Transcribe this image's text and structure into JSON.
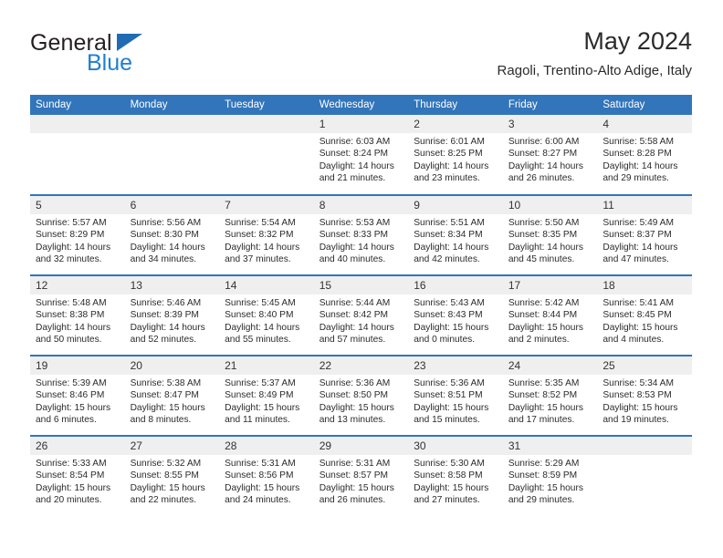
{
  "brand": {
    "name_part1": "General",
    "name_part2": "Blue",
    "triangle_color": "#1f6cb4",
    "blue_color": "#1f7fd0"
  },
  "header": {
    "title": "May 2024",
    "subtitle": "Ragoli, Trentino-Alto Adige, Italy"
  },
  "theme": {
    "header_bg": "#3275ba",
    "daynum_bg": "#efefef",
    "row_divider": "#3275ba",
    "text": "#2b2b2b"
  },
  "calendar": {
    "weekday_headers": [
      "Sunday",
      "Monday",
      "Tuesday",
      "Wednesday",
      "Thursday",
      "Friday",
      "Saturday"
    ],
    "weeks": [
      [
        {
          "day": "",
          "empty": true
        },
        {
          "day": "",
          "empty": true
        },
        {
          "day": "",
          "empty": true
        },
        {
          "day": "1",
          "sunrise": "Sunrise: 6:03 AM",
          "sunset": "Sunset: 8:24 PM",
          "daylight_1": "Daylight: 14 hours",
          "daylight_2": "and 21 minutes."
        },
        {
          "day": "2",
          "sunrise": "Sunrise: 6:01 AM",
          "sunset": "Sunset: 8:25 PM",
          "daylight_1": "Daylight: 14 hours",
          "daylight_2": "and 23 minutes."
        },
        {
          "day": "3",
          "sunrise": "Sunrise: 6:00 AM",
          "sunset": "Sunset: 8:27 PM",
          "daylight_1": "Daylight: 14 hours",
          "daylight_2": "and 26 minutes."
        },
        {
          "day": "4",
          "sunrise": "Sunrise: 5:58 AM",
          "sunset": "Sunset: 8:28 PM",
          "daylight_1": "Daylight: 14 hours",
          "daylight_2": "and 29 minutes."
        }
      ],
      [
        {
          "day": "5",
          "sunrise": "Sunrise: 5:57 AM",
          "sunset": "Sunset: 8:29 PM",
          "daylight_1": "Daylight: 14 hours",
          "daylight_2": "and 32 minutes."
        },
        {
          "day": "6",
          "sunrise": "Sunrise: 5:56 AM",
          "sunset": "Sunset: 8:30 PM",
          "daylight_1": "Daylight: 14 hours",
          "daylight_2": "and 34 minutes."
        },
        {
          "day": "7",
          "sunrise": "Sunrise: 5:54 AM",
          "sunset": "Sunset: 8:32 PM",
          "daylight_1": "Daylight: 14 hours",
          "daylight_2": "and 37 minutes."
        },
        {
          "day": "8",
          "sunrise": "Sunrise: 5:53 AM",
          "sunset": "Sunset: 8:33 PM",
          "daylight_1": "Daylight: 14 hours",
          "daylight_2": "and 40 minutes."
        },
        {
          "day": "9",
          "sunrise": "Sunrise: 5:51 AM",
          "sunset": "Sunset: 8:34 PM",
          "daylight_1": "Daylight: 14 hours",
          "daylight_2": "and 42 minutes."
        },
        {
          "day": "10",
          "sunrise": "Sunrise: 5:50 AM",
          "sunset": "Sunset: 8:35 PM",
          "daylight_1": "Daylight: 14 hours",
          "daylight_2": "and 45 minutes."
        },
        {
          "day": "11",
          "sunrise": "Sunrise: 5:49 AM",
          "sunset": "Sunset: 8:37 PM",
          "daylight_1": "Daylight: 14 hours",
          "daylight_2": "and 47 minutes."
        }
      ],
      [
        {
          "day": "12",
          "sunrise": "Sunrise: 5:48 AM",
          "sunset": "Sunset: 8:38 PM",
          "daylight_1": "Daylight: 14 hours",
          "daylight_2": "and 50 minutes."
        },
        {
          "day": "13",
          "sunrise": "Sunrise: 5:46 AM",
          "sunset": "Sunset: 8:39 PM",
          "daylight_1": "Daylight: 14 hours",
          "daylight_2": "and 52 minutes."
        },
        {
          "day": "14",
          "sunrise": "Sunrise: 5:45 AM",
          "sunset": "Sunset: 8:40 PM",
          "daylight_1": "Daylight: 14 hours",
          "daylight_2": "and 55 minutes."
        },
        {
          "day": "15",
          "sunrise": "Sunrise: 5:44 AM",
          "sunset": "Sunset: 8:42 PM",
          "daylight_1": "Daylight: 14 hours",
          "daylight_2": "and 57 minutes."
        },
        {
          "day": "16",
          "sunrise": "Sunrise: 5:43 AM",
          "sunset": "Sunset: 8:43 PM",
          "daylight_1": "Daylight: 15 hours",
          "daylight_2": "and 0 minutes."
        },
        {
          "day": "17",
          "sunrise": "Sunrise: 5:42 AM",
          "sunset": "Sunset: 8:44 PM",
          "daylight_1": "Daylight: 15 hours",
          "daylight_2": "and 2 minutes."
        },
        {
          "day": "18",
          "sunrise": "Sunrise: 5:41 AM",
          "sunset": "Sunset: 8:45 PM",
          "daylight_1": "Daylight: 15 hours",
          "daylight_2": "and 4 minutes."
        }
      ],
      [
        {
          "day": "19",
          "sunrise": "Sunrise: 5:39 AM",
          "sunset": "Sunset: 8:46 PM",
          "daylight_1": "Daylight: 15 hours",
          "daylight_2": "and 6 minutes."
        },
        {
          "day": "20",
          "sunrise": "Sunrise: 5:38 AM",
          "sunset": "Sunset: 8:47 PM",
          "daylight_1": "Daylight: 15 hours",
          "daylight_2": "and 8 minutes."
        },
        {
          "day": "21",
          "sunrise": "Sunrise: 5:37 AM",
          "sunset": "Sunset: 8:49 PM",
          "daylight_1": "Daylight: 15 hours",
          "daylight_2": "and 11 minutes."
        },
        {
          "day": "22",
          "sunrise": "Sunrise: 5:36 AM",
          "sunset": "Sunset: 8:50 PM",
          "daylight_1": "Daylight: 15 hours",
          "daylight_2": "and 13 minutes."
        },
        {
          "day": "23",
          "sunrise": "Sunrise: 5:36 AM",
          "sunset": "Sunset: 8:51 PM",
          "daylight_1": "Daylight: 15 hours",
          "daylight_2": "and 15 minutes."
        },
        {
          "day": "24",
          "sunrise": "Sunrise: 5:35 AM",
          "sunset": "Sunset: 8:52 PM",
          "daylight_1": "Daylight: 15 hours",
          "daylight_2": "and 17 minutes."
        },
        {
          "day": "25",
          "sunrise": "Sunrise: 5:34 AM",
          "sunset": "Sunset: 8:53 PM",
          "daylight_1": "Daylight: 15 hours",
          "daylight_2": "and 19 minutes."
        }
      ],
      [
        {
          "day": "26",
          "sunrise": "Sunrise: 5:33 AM",
          "sunset": "Sunset: 8:54 PM",
          "daylight_1": "Daylight: 15 hours",
          "daylight_2": "and 20 minutes."
        },
        {
          "day": "27",
          "sunrise": "Sunrise: 5:32 AM",
          "sunset": "Sunset: 8:55 PM",
          "daylight_1": "Daylight: 15 hours",
          "daylight_2": "and 22 minutes."
        },
        {
          "day": "28",
          "sunrise": "Sunrise: 5:31 AM",
          "sunset": "Sunset: 8:56 PM",
          "daylight_1": "Daylight: 15 hours",
          "daylight_2": "and 24 minutes."
        },
        {
          "day": "29",
          "sunrise": "Sunrise: 5:31 AM",
          "sunset": "Sunset: 8:57 PM",
          "daylight_1": "Daylight: 15 hours",
          "daylight_2": "and 26 minutes."
        },
        {
          "day": "30",
          "sunrise": "Sunrise: 5:30 AM",
          "sunset": "Sunset: 8:58 PM",
          "daylight_1": "Daylight: 15 hours",
          "daylight_2": "and 27 minutes."
        },
        {
          "day": "31",
          "sunrise": "Sunrise: 5:29 AM",
          "sunset": "Sunset: 8:59 PM",
          "daylight_1": "Daylight: 15 hours",
          "daylight_2": "and 29 minutes."
        },
        {
          "day": "",
          "empty": true
        }
      ]
    ]
  }
}
